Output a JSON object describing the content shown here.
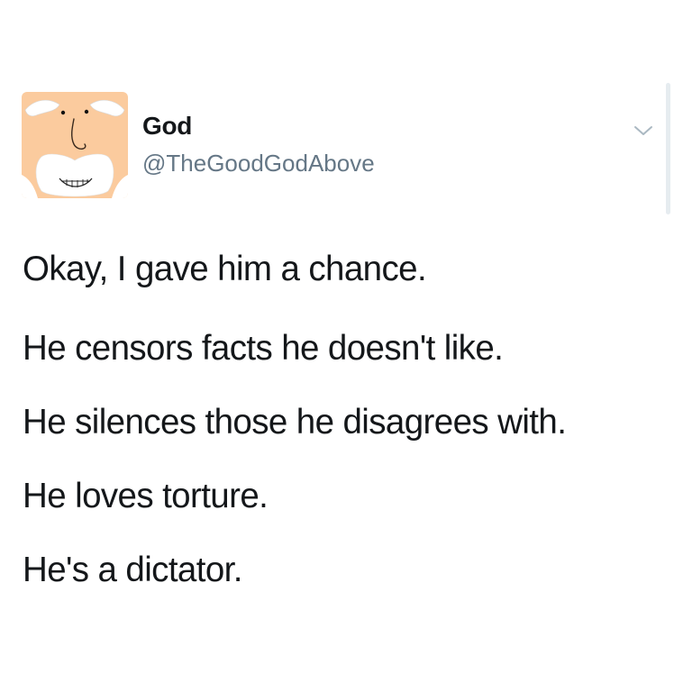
{
  "tweet": {
    "author": {
      "display_name": "God",
      "handle": "@TheGoodGodAbove",
      "avatar_icon": "cartoon-god-face-icon"
    },
    "menu_icon": "chevron-down-icon",
    "lines": [
      "Okay, I gave him a chance.",
      "He censors facts he doesn't like.",
      "He silences those he disagrees with.",
      "He loves torture.",
      "He's a dictator."
    ]
  },
  "colors": {
    "text_primary": "#14171a",
    "text_secondary": "#657786",
    "avatar_skin": "#fbcb9e",
    "background": "#ffffff"
  }
}
